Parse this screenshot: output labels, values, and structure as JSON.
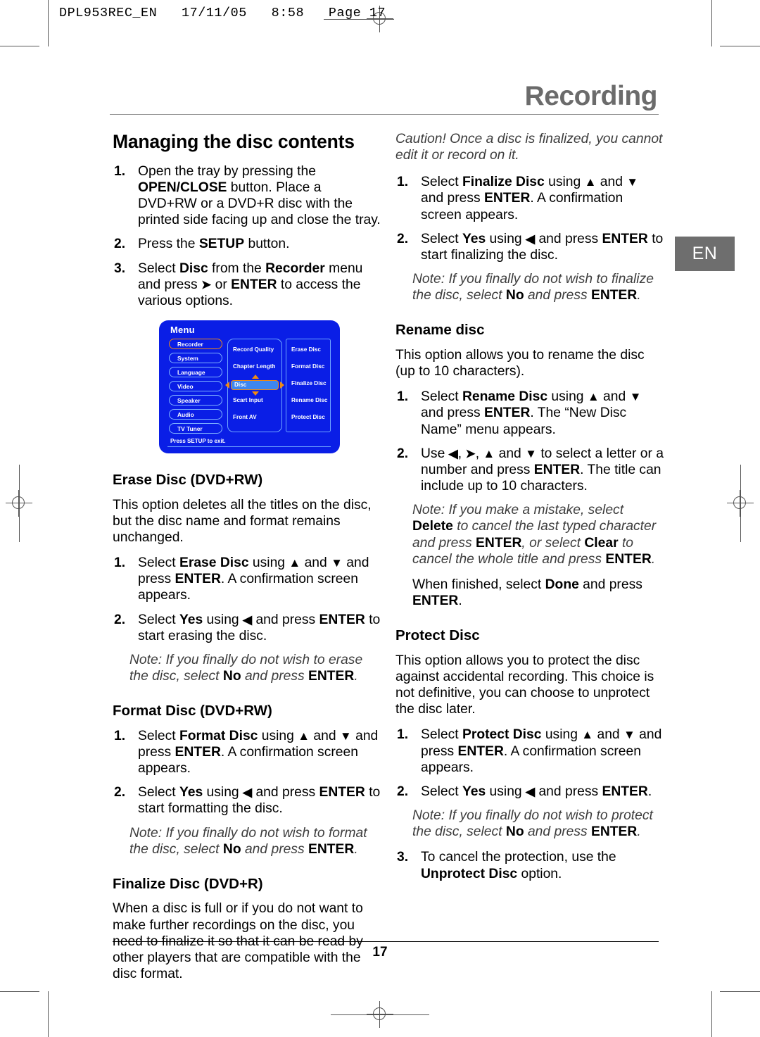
{
  "print_slug": "DPL953REC_EN   17/11/05   8:58   Page 17",
  "chapter_title": "Recording",
  "language_tab": "EN",
  "page_number": "17",
  "left_column": {
    "section_title": "Managing the disc contents",
    "intro_steps": [
      {
        "num": "1.",
        "html": "Open the tray by pressing the <b>OPEN/CLOSE</b> button. Place a DVD+RW or a DVD+R disc with the printed side facing up and close the tray."
      },
      {
        "num": "2.",
        "html": "Press the <b>SETUP</b> button."
      },
      {
        "num": "3.",
        "html": "Select <b>Disc</b> from the <b>Recorder</b> menu and press <b class=\"arrow\">&#10148;</b> or <b>ENTER</b> to access the various options."
      }
    ],
    "erase": {
      "title": "Erase Disc (DVD+RW)",
      "body": "This option deletes all the titles on the disc, but the disc name and format remains unchanged.",
      "steps": [
        {
          "num": "1.",
          "html": "Select <b>Erase Disc</b> using <b class=\"arrow\">&#9650;</b> and <b class=\"arrow\">&#9660;</b> and press <b>ENTER</b>. A confirmation screen appears."
        },
        {
          "num": "2.",
          "html": "Select <b>Yes</b> using <b class=\"arrow\">&#9664;</b> and press <b>ENTER</b> to start erasing the disc."
        }
      ],
      "note": "Note: If you finally do not wish to erase the disc, select <b>No</b> and press <b>ENTER</b>."
    },
    "format": {
      "title": "Format Disc (DVD+RW)",
      "steps": [
        {
          "num": "1.",
          "html": "Select <b>Format Disc</b> using <b class=\"arrow\">&#9650;</b> and <b class=\"arrow\">&#9660;</b> and press <b>ENTER</b>. A confirmation screen appears."
        },
        {
          "num": "2.",
          "html": "Select <b>Yes</b> using <b class=\"arrow\">&#9664;</b> and press <b>ENTER</b> to start formatting the disc."
        }
      ],
      "note": "Note: If you finally do not wish to format the disc, select <b>No</b> and press <b>ENTER</b>."
    },
    "finalize": {
      "title": "Finalize Disc (DVD+R)",
      "body": "When a disc is full or if you do not want to make further recordings on the disc, you need to finalize it so that it can be read by other players that are compatible with the disc format."
    }
  },
  "right_column": {
    "caution": "Caution! Once a disc is finalized, you cannot edit it or record on it.",
    "finalize_steps": [
      {
        "num": "1.",
        "html": "Select <b>Finalize Disc</b> using <b class=\"arrow\">&#9650;</b> and <b class=\"arrow\">&#9660;</b> and press <b>ENTER</b>. A confirmation screen appears."
      },
      {
        "num": "2.",
        "html": "Select <b>Yes</b> using <b class=\"arrow\">&#9664;</b> and press <b>ENTER</b> to start finalizing the disc."
      }
    ],
    "finalize_note": "Note: If you finally do not wish to finalize the disc, select <b>No</b> and press <b>ENTER</b>.",
    "rename": {
      "title": "Rename disc",
      "body": "This option allows you to rename the disc (up to 10 characters).",
      "steps": [
        {
          "num": "1.",
          "html": "Select <b>Rename Disc</b> using <b class=\"arrow\">&#9650;</b> and <b class=\"arrow\">&#9660;</b> and press <b>ENTER</b>. The “New Disc Name” menu appears."
        },
        {
          "num": "2.",
          "html": "Use <b class=\"arrow\">&#9664;</b>, <b class=\"arrow\">&#10148;</b>, <b class=\"arrow\">&#9650;</b> and <b class=\"arrow\">&#9660;</b> to select a letter or a number and press <b>ENTER</b>. The title can include up to 10 characters."
        }
      ],
      "note": "Note: If you make a mistake, select <b>Delete</b> to cancel the last typed character and press <b>ENTER</b>, or select <b>Clear</b> to cancel the whole title and press <b>ENTER</b>.",
      "finished": "When finished, select <b>Done</b> and press <b>ENTER</b>."
    },
    "protect": {
      "title": "Protect Disc",
      "body": "This option allows you to protect the disc against accidental recording. This choice is not definitive, you can choose to unprotect the disc later.",
      "steps": [
        {
          "num": "1.",
          "html": "Select <b>Protect Disc</b> using <b class=\"arrow\">&#9650;</b> and <b class=\"arrow\">&#9660;</b> and press <b>ENTER</b>. A confirmation screen appears."
        },
        {
          "num": "2.",
          "html": "Select <b>Yes</b> using <b class=\"arrow\">&#9664;</b> and press <b>ENTER</b>."
        }
      ],
      "note": "Note: If you finally do not wish to protect the disc, select <b>No</b> and press <b>ENTER</b>.",
      "step3": {
        "num": "3.",
        "html": "To cancel the protection, use the <b>Unprotect Disc</b> option."
      }
    }
  },
  "osd_menu": {
    "title": "Menu",
    "footer": "Press SETUP to exit.",
    "categories": [
      "Recorder",
      "System",
      "Language",
      "Video",
      "Speaker",
      "Audio",
      "TV Tuner"
    ],
    "selected_category": "Recorder",
    "options": [
      "Record Quality",
      "Chapter Length",
      "Disc",
      "Scart Input",
      "Front AV"
    ],
    "selected_option": "Disc",
    "sub_options": [
      "Erase Disc",
      "Format Disc",
      "Finalize Disc",
      "Rename Disc",
      "Protect Disc"
    ],
    "colors": {
      "background": "#0a1ee6",
      "border": "#6fa6ff",
      "highlight": "#3e86f0",
      "accent": "#f08a14"
    }
  }
}
